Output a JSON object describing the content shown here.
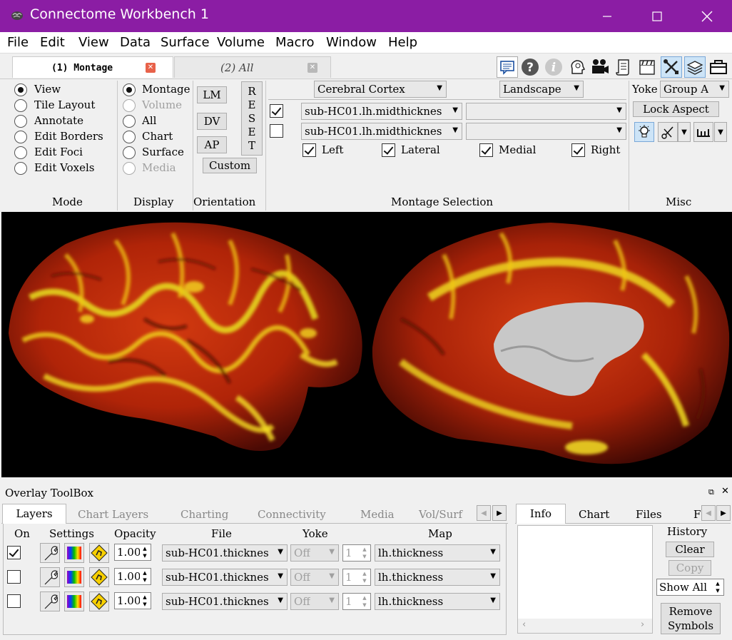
{
  "window": {
    "title": "Connectome Workbench 1"
  },
  "menu": [
    "File",
    "Edit",
    "View",
    "Data",
    "Surface",
    "Volume",
    "Macro",
    "Window",
    "Help"
  ],
  "tabs": [
    {
      "label": "(1) Montage",
      "active": true
    },
    {
      "label": "(2) All",
      "active": false
    }
  ],
  "mode": {
    "title": "Mode",
    "options": [
      "View",
      "Tile Layout",
      "Annotate",
      "Edit Borders",
      "Edit Foci",
      "Edit Voxels"
    ],
    "selected": 0
  },
  "display": {
    "title": "Display",
    "options": [
      "Montage",
      "Volume",
      "All",
      "Chart",
      "Surface",
      "Media"
    ],
    "selected": 0,
    "disabled": [
      1,
      5
    ]
  },
  "orientation": {
    "title": "Orientation",
    "buttons": [
      "LM",
      "DV",
      "AP"
    ],
    "reset": [
      "R",
      "E",
      "S",
      "E",
      "T"
    ],
    "custom": "Custom"
  },
  "montage": {
    "title": "Montage Selection",
    "structure": "Cerebral Cortex",
    "layout": "Landscape",
    "surfaces": [
      {
        "checked": true,
        "file": "sub-HC01.lh.midthicknes",
        "second": ""
      },
      {
        "checked": false,
        "file": "sub-HC01.lh.midthicknes",
        "second": ""
      }
    ],
    "views": [
      {
        "label": "Left",
        "checked": true
      },
      {
        "label": "Lateral",
        "checked": true
      },
      {
        "label": "Medial",
        "checked": true
      },
      {
        "label": "Right",
        "checked": true
      }
    ]
  },
  "misc": {
    "title": "Misc",
    "yoke_label": "Yoke",
    "yoke_group": "Group A",
    "lock_aspect": "Lock Aspect"
  },
  "overlay": {
    "title": "Overlay ToolBox",
    "tabs": [
      "Layers",
      "Chart Layers",
      "Charting",
      "Connectivity",
      "Media",
      "Vol/Surf"
    ],
    "headers": {
      "on": "On",
      "settings": "Settings",
      "opacity": "Opacity",
      "file": "File",
      "yoke": "Yoke",
      "map": "Map"
    },
    "layers": [
      {
        "on": true,
        "opacity": "1.00",
        "file": "sub-HC01.thicknes",
        "yoke": "Off",
        "mapnum": "1",
        "map": "lh.thickness"
      },
      {
        "on": false,
        "opacity": "1.00",
        "file": "sub-HC01.thicknes",
        "yoke": "Off",
        "mapnum": "1",
        "map": "lh.thickness"
      },
      {
        "on": false,
        "opacity": "1.00",
        "file": "sub-HC01.thicknes",
        "yoke": "Off",
        "mapnum": "1",
        "map": "lh.thickness"
      }
    ]
  },
  "info": {
    "tabs": [
      "Info",
      "Chart",
      "Files",
      "F"
    ],
    "history_label": "History",
    "clear": "Clear",
    "copy": "Copy",
    "show_all": "Show All",
    "remove_symbols_1": "Remove",
    "remove_symbols_2": "Symbols"
  }
}
